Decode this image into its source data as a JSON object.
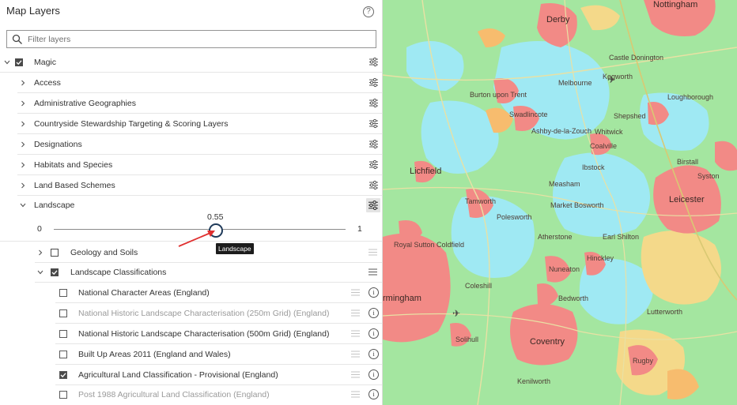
{
  "panel": {
    "title": "Map Layers",
    "help_glyph": "?",
    "filter_placeholder": "Filter layers"
  },
  "layers": {
    "root": {
      "label": "Magic",
      "checked": true,
      "expanded": true
    },
    "groups": [
      {
        "label": "Access"
      },
      {
        "label": "Administrative Geographies"
      },
      {
        "label": "Countryside Stewardship Targeting & Scoring Layers"
      },
      {
        "label": "Designations"
      },
      {
        "label": "Habitats and Species"
      },
      {
        "label": "Land Based Schemes"
      },
      {
        "label": "Landscape"
      }
    ],
    "opacity_slider": {
      "min": "0",
      "max": "1",
      "value": "0.55",
      "value_fraction": 0.55,
      "tooltip": "Landscape"
    },
    "sublayers": [
      {
        "label": "Geology and Soils",
        "checked": false
      },
      {
        "label": "Landscape Classifications",
        "checked": true
      }
    ],
    "classification_items": [
      {
        "label": "National Character Areas (England)",
        "checked": false,
        "dimmed": false
      },
      {
        "label": "National Historic Landscape Characterisation (250m Grid) (England)",
        "checked": false,
        "dimmed": true
      },
      {
        "label": "National Historic Landscape Characterisation (500m Grid) (England)",
        "checked": false,
        "dimmed": false
      },
      {
        "label": "Built Up Areas 2011 (England and Wales)",
        "checked": false,
        "dimmed": false
      },
      {
        "label": "Agricultural Land Classification - Provisional (England)",
        "checked": true,
        "dimmed": false
      },
      {
        "label": "Post 1988 Agricultural Land Classification (England)",
        "checked": false,
        "dimmed": true
      }
    ],
    "info_glyph": "i"
  },
  "map": {
    "cities": [
      "Derby",
      "Nottingham",
      "Leicester",
      "Lichfield",
      "Coventry",
      "rmingham"
    ],
    "towns": [
      "Burton upon Trent",
      "Swadlincote",
      "Coalville",
      "Shepshed",
      "Ashby-de-la-Zouch",
      "Tamworth",
      "Atherstone",
      "Nuneaton",
      "Hinckley",
      "Market Bosworth",
      "Bedworth",
      "Rugby",
      "Solihull",
      "Royal Sutton Coldfield",
      "Melbourne",
      "Kegworth",
      "Ibstock",
      "Earl Shilton",
      "Lutterworth",
      "Kenilworth",
      "Castle Donington",
      "Polesworth",
      "Coleshill",
      "Measham",
      "Syston",
      "Birstall",
      "Whitwick",
      "Loughborough"
    ],
    "colors": {
      "built_up": "#f28a86",
      "grade_green": "#a4e6a0",
      "grade_cyan": "#9fe9f3",
      "grade_yellow": "#f4d98a",
      "grade_orange": "#f7bc6e"
    }
  }
}
